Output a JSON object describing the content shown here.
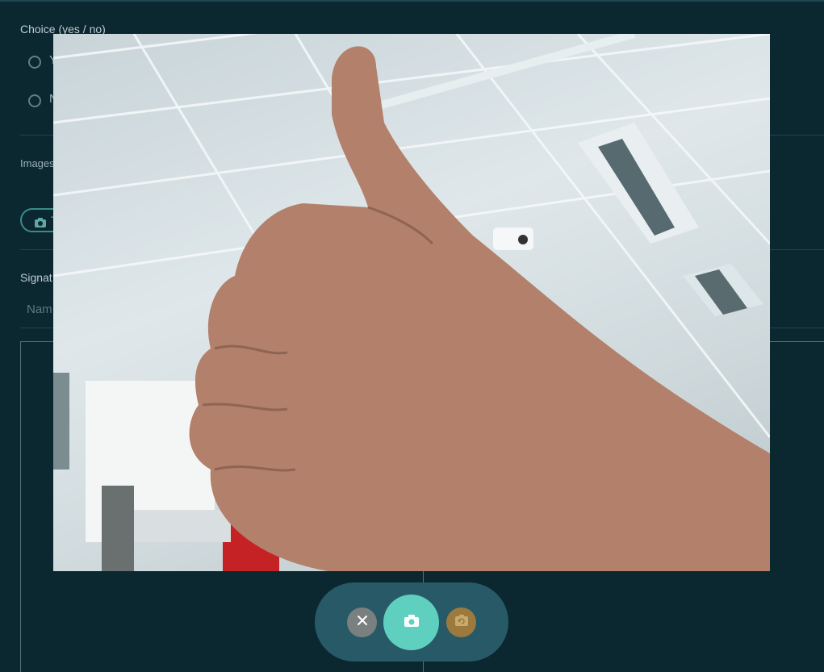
{
  "form": {
    "choice_label": "Choice (yes / no)",
    "choice_options": [
      "Y",
      "N"
    ],
    "images_label": "Images",
    "take_photo_label": "T",
    "signature_label": "Signat",
    "name_placeholder": "Nam"
  },
  "camera": {
    "controls": {
      "close_icon": "close-icon",
      "capture_icon": "camera-icon",
      "switch_icon": "switch-camera-icon"
    }
  },
  "colors": {
    "background": "#0b2730",
    "controls_bar": "#275a66",
    "close_button": "#7a7f80",
    "capture_button": "#5fcfc0",
    "switch_button": "#9c7a3e"
  }
}
